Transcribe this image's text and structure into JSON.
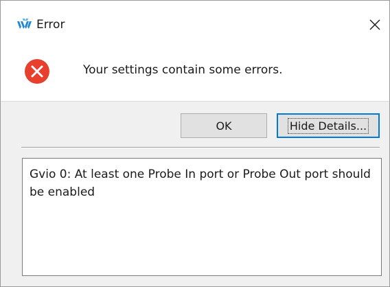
{
  "window": {
    "title": "Error",
    "icon": "app-logo-icon",
    "close_icon": "close-icon"
  },
  "message": {
    "icon": "error-icon",
    "icon_color": "#e8402e",
    "text": "Your settings contain some errors."
  },
  "buttons": {
    "ok_label": "OK",
    "details_label": "Hide Details..."
  },
  "details": {
    "text": "Gvio 0: At least one Probe In port or Probe Out port should be enabled"
  },
  "colors": {
    "focus_accent": "#0078d7",
    "logo": "#1e88d4"
  }
}
